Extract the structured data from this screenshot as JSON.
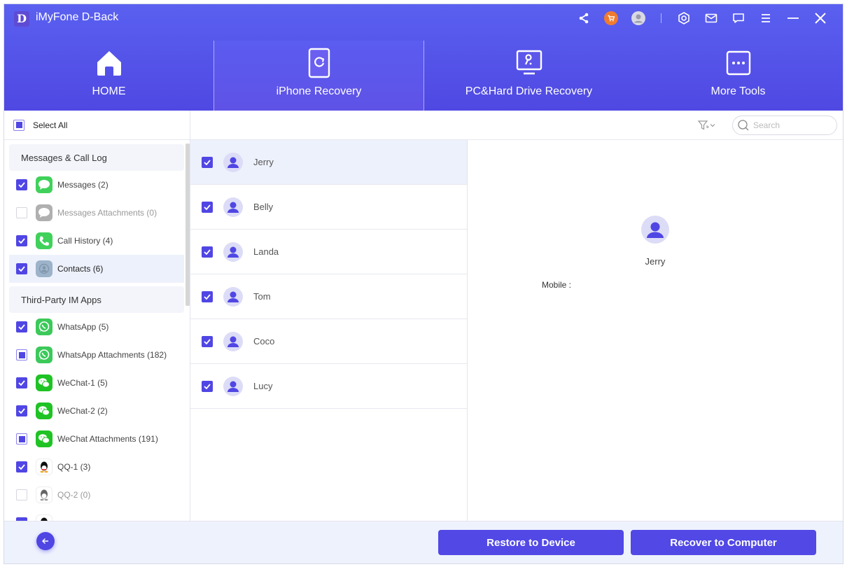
{
  "app": {
    "logo_letter": "D",
    "title": "iMyFone D-Back"
  },
  "titlebar_icons": [
    "share-icon",
    "cart-icon",
    "account-icon",
    "settings-icon",
    "mail-icon",
    "feedback-icon",
    "menu-icon",
    "minimize-icon",
    "close-icon"
  ],
  "nav": {
    "tabs": [
      {
        "label": "HOME",
        "icon": "home-icon",
        "active": false
      },
      {
        "label": "iPhone Recovery",
        "icon": "iphone-recovery-icon",
        "active": true
      },
      {
        "label": "PC&Hard Drive Recovery",
        "icon": "pc-drive-icon",
        "active": false
      },
      {
        "label": "More Tools",
        "icon": "more-tools-icon",
        "active": false
      }
    ]
  },
  "sidebar": {
    "select_all_label": "Select All",
    "select_all_state": "partial",
    "groups": [
      {
        "title": "Messages & Call Log",
        "items": [
          {
            "label": "Messages (2)",
            "icon": "messages-icon",
            "state": "checked"
          },
          {
            "label": "Messages Attachments (0)",
            "icon": "messages-attachments-icon",
            "state": "unchecked",
            "disabled": true
          },
          {
            "label": "Call History (4)",
            "icon": "phone-icon",
            "state": "checked"
          },
          {
            "label": "Contacts (6)",
            "icon": "contacts-icon",
            "state": "checked",
            "active": true
          }
        ]
      },
      {
        "title": "Third-Party IM Apps",
        "items": [
          {
            "label": "WhatsApp (5)",
            "icon": "whatsapp-icon",
            "state": "checked"
          },
          {
            "label": "WhatsApp Attachments (182)",
            "icon": "whatsapp-icon",
            "state": "partial"
          },
          {
            "label": "WeChat-1 (5)",
            "icon": "wechat-icon",
            "state": "checked"
          },
          {
            "label": "WeChat-2 (2)",
            "icon": "wechat-icon",
            "state": "checked"
          },
          {
            "label": "WeChat Attachments (191)",
            "icon": "wechat-icon",
            "state": "partial"
          },
          {
            "label": "QQ-1 (3)",
            "icon": "qq-icon",
            "state": "checked"
          },
          {
            "label": "QQ-2 (0)",
            "icon": "qq-icon",
            "state": "unchecked",
            "disabled": true
          }
        ]
      }
    ]
  },
  "toolbar": {
    "search_placeholder": "Search",
    "search_value": ""
  },
  "contacts": [
    {
      "name": "Jerry",
      "checked": true,
      "selected": true
    },
    {
      "name": "Belly",
      "checked": true
    },
    {
      "name": "Landa",
      "checked": true
    },
    {
      "name": "Tom",
      "checked": true
    },
    {
      "name": "Coco",
      "checked": true
    },
    {
      "name": "Lucy",
      "checked": true
    }
  ],
  "detail": {
    "name": "Jerry",
    "mobile_label": "Mobile :",
    "mobile_value": ""
  },
  "footer": {
    "restore_label": "Restore to Device",
    "recover_label": "Recover to Computer"
  },
  "colors": {
    "accent": "#5046e4",
    "header_top": "#5a60f0",
    "header_bottom": "#4f48e2",
    "cart_badge": "#f07b2e",
    "selected_row": "#edf1fc"
  }
}
